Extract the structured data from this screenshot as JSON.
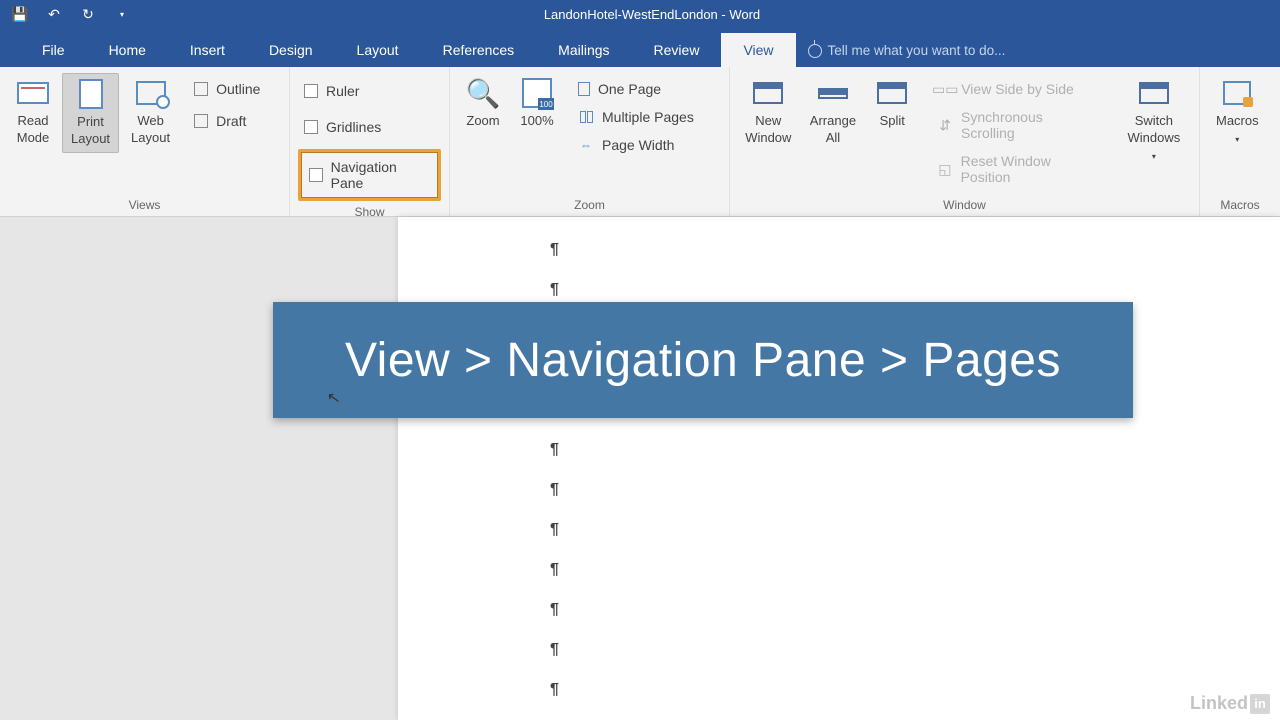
{
  "titlebar": {
    "title": "LandonHotel-WestEndLondon - Word"
  },
  "tabs": {
    "items": [
      "File",
      "Home",
      "Insert",
      "Design",
      "Layout",
      "References",
      "Mailings",
      "Review",
      "View"
    ],
    "active": "View",
    "tellme": "Tell me what you want to do..."
  },
  "ribbon": {
    "views": {
      "label": "Views",
      "read_mode": "Read\nMode",
      "print_layout": "Print\nLayout",
      "web_layout": "Web\nLayout",
      "outline": "Outline",
      "draft": "Draft"
    },
    "show": {
      "label": "Show",
      "ruler": "Ruler",
      "gridlines": "Gridlines",
      "navpane": "Navigation Pane"
    },
    "zoom": {
      "label": "Zoom",
      "zoom": "Zoom",
      "hundred": "100%",
      "one_page": "One Page",
      "multiple_pages": "Multiple Pages",
      "page_width": "Page Width"
    },
    "window": {
      "label": "Window",
      "new_window": "New\nWindow",
      "arrange_all": "Arrange\nAll",
      "split": "Split",
      "side_by_side": "View Side by Side",
      "sync_scroll": "Synchronous Scrolling",
      "reset_pos": "Reset Window Position",
      "switch": "Switch\nWindows"
    },
    "macros": {
      "label": "Macros",
      "button": "Macros"
    }
  },
  "banner": {
    "text": "View > Navigation Pane > Pages"
  },
  "linkedin": {
    "text": "Linked",
    "in": "in"
  }
}
